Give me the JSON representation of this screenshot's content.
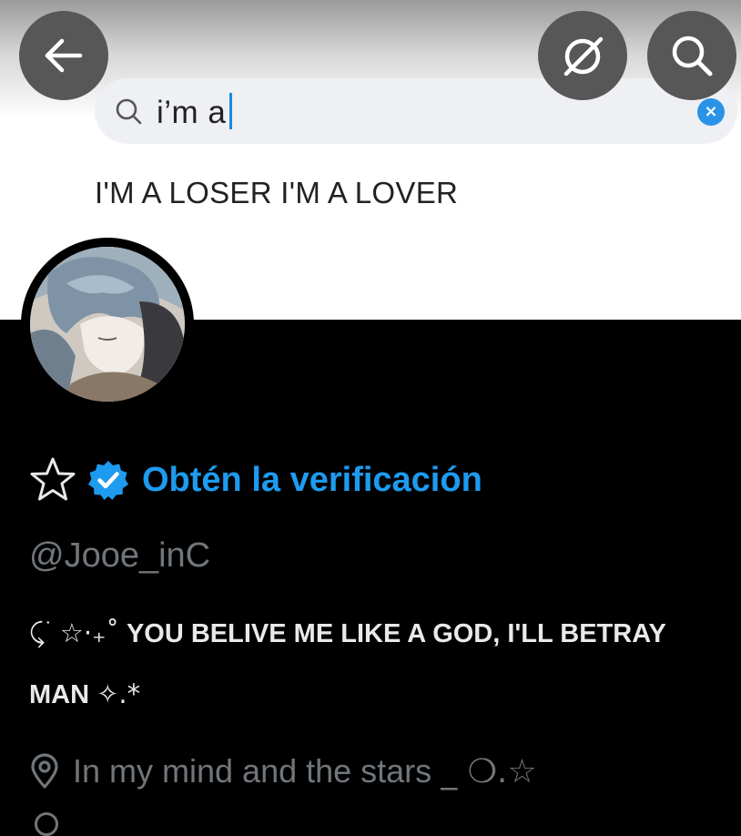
{
  "banner": {
    "search_query": "i’m a",
    "clear_symbol": "×",
    "suggestion": "I'M A LOSER I'M A LOVER"
  },
  "top_buttons": {
    "back_icon": "arrow-left-icon",
    "grok_icon": "grok-slash-icon",
    "search_icon": "search-icon"
  },
  "profile": {
    "star_badge": "☆",
    "verify_icon": "verified-badge-icon",
    "verify_label": "Obtén la verificación",
    "handle": "@Jooe_inC",
    "bio_line1_deco": "⤹ ࣪ ☆·₊˚",
    "bio_line1_text": "YOU BELIVE ME LIKE A GOD, I'LL BETRAY",
    "bio_line2_text": "MAN",
    "bio_line2_deco": "✧.*",
    "location_icon": "location-pin-icon",
    "location_text": "In my mind and the stars",
    "location_deco": "_ ❍.☆"
  },
  "colors": {
    "accent": "#1d9bf0",
    "muted": "#71767b",
    "text": "#e7e9ea",
    "background": "#000000",
    "overlay_button": "#575757"
  }
}
